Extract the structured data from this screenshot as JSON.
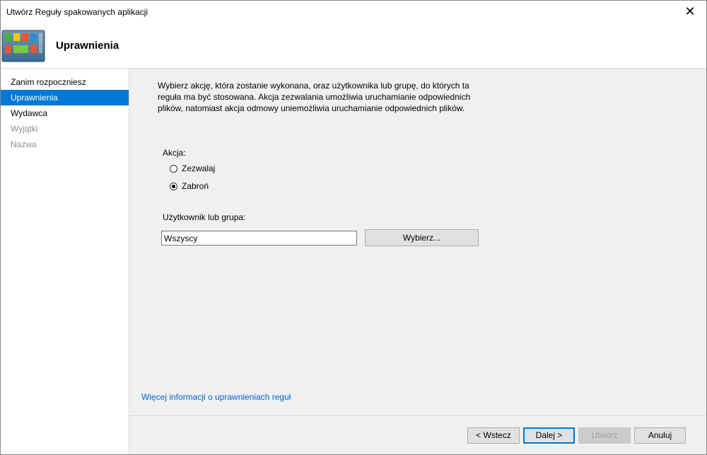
{
  "window": {
    "title": "Utwórz Reguły spakowanych aplikacji",
    "close_glyph": "✕"
  },
  "header": {
    "title": "Uprawnienia",
    "icon": "app-tiles-icon"
  },
  "sidebar": {
    "items": [
      {
        "label": "Zanim rozpoczniesz",
        "state": "normal"
      },
      {
        "label": "Uprawnienia",
        "state": "active"
      },
      {
        "label": "Wydawca",
        "state": "normal"
      },
      {
        "label": "Wyjątki",
        "state": "disabled"
      },
      {
        "label": "Nazwa",
        "state": "disabled"
      }
    ]
  },
  "content": {
    "description": "Wybierz akcję, która zostanie wykonana, oraz użytkownika lub grupę, do których ta reguła ma być stosowana. Akcja zezwalania umożliwia uruchamianie odpowiednich plików, natomiast akcja odmowy uniemożliwia uruchamianie odpowiednich plików.",
    "action_label": "Akcja:",
    "options": [
      {
        "label": "Zezwalaj",
        "checked": false
      },
      {
        "label": "Zabroń",
        "checked": true
      }
    ],
    "user_label": "Użytkownik lub grupa:",
    "user_value": "Wszyscy",
    "select_button": "Wybierz...",
    "more_info_link": "Więcej informacji o uprawnieniach reguł"
  },
  "footer": {
    "back": "< Wstecz",
    "next": "Dalej >",
    "create": "Utwórz",
    "cancel": "Anuluj"
  }
}
